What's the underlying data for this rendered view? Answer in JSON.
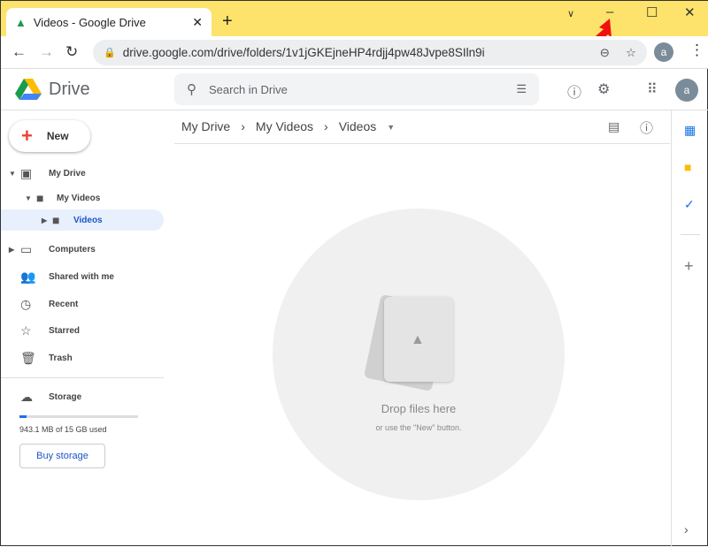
{
  "browser": {
    "tab_title": "Videos - Google Drive",
    "url": "drive.google.com/drive/folders/1v1jGKEjneHP4rdjj4pw48Jvpe8SIln9i",
    "avatar": "a"
  },
  "header": {
    "app_name": "Drive",
    "search_placeholder": "Search in Drive",
    "avatar": "a"
  },
  "sidebar": {
    "new_label": "New",
    "items": [
      {
        "label": "My Drive"
      },
      {
        "label": "My Videos"
      },
      {
        "label": "Videos"
      },
      {
        "label": "Computers"
      },
      {
        "label": "Shared with me"
      },
      {
        "label": "Recent"
      },
      {
        "label": "Starred"
      },
      {
        "label": "Trash"
      }
    ],
    "storage_label": "Storage",
    "storage_used": "943.1 MB of 15 GB used",
    "storage_fraction": 0.06,
    "buy_label": "Buy storage"
  },
  "breadcrumb": [
    "My Drive",
    "My Videos",
    "Videos"
  ],
  "empty": {
    "title": "Drop files here",
    "subtitle": "or use the \"New\" button."
  },
  "colors": {
    "titlebar": "#fde36b",
    "accent": "#1a73e8"
  }
}
